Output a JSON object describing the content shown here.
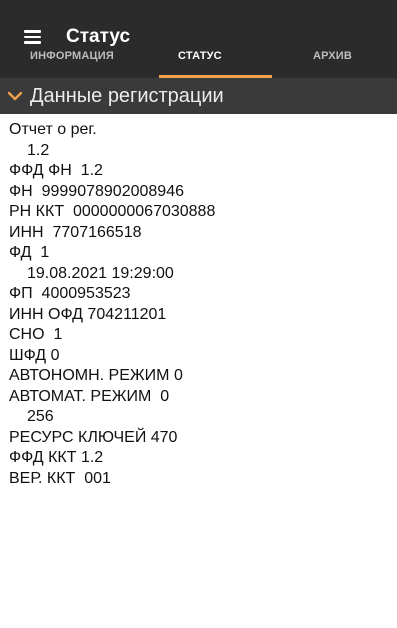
{
  "appbar": {
    "menu_icon": "hamburger-icon",
    "title": "Статус"
  },
  "tabs": [
    {
      "label": "ИНФОРМАЦИЯ",
      "active": false
    },
    {
      "label": "СТАТУС",
      "active": true
    },
    {
      "label": "АРХИВ",
      "active": false
    }
  ],
  "accent_color": "#f0a04b",
  "section": {
    "icon": "chevron-down-icon",
    "title": "Данные регистрации"
  },
  "lines": [
    "Отчет о рег.",
    "1.2",
    "ФФД ФН  1.2",
    "ФН  9999078902008946",
    "РН ККТ  0000000067030888",
    "ИНН  7707166518",
    "ФД  1",
    "19.08.2021 19:29:00",
    "ФП  4000953523",
    "ИНН ОФД 704211201",
    "СНО  1",
    "ШФД 0",
    "АВТОНОМН. РЕЖИМ 0",
    "АВТОМАТ. РЕЖИМ  0",
    "256",
    "РЕСУРС КЛЮЧЕЙ 470",
    "ФФД ККТ 1.2",
    "ВЕР. ККТ  001"
  ]
}
